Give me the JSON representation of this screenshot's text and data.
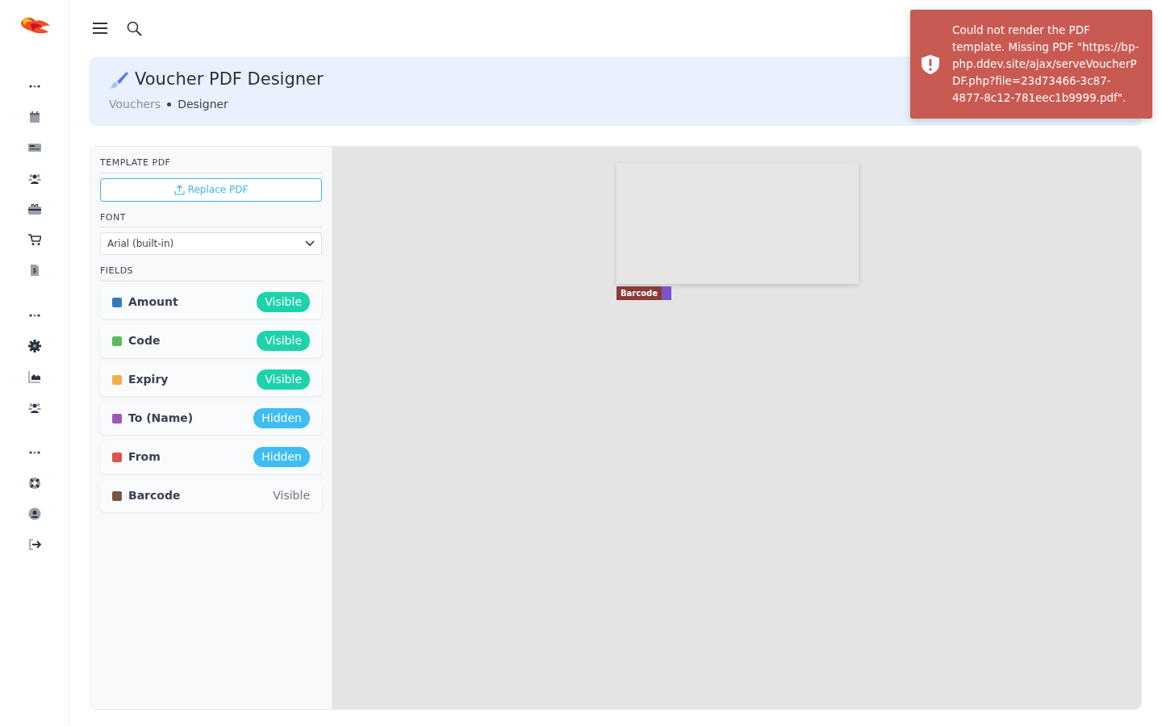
{
  "header": {
    "title": "Voucher PDF Designer",
    "breadcrumbs": [
      {
        "label": "Vouchers",
        "selected": false
      },
      {
        "label": "Designer",
        "selected": true
      }
    ]
  },
  "sections": {
    "template": "TEMPLATE PDF",
    "replace_button": "Replace PDF",
    "font": "FONT",
    "font_value": "Arial (built-in)",
    "fields": "FIELDS"
  },
  "fields": [
    {
      "name": "Amount",
      "color": "#337ab7",
      "status": "Visible",
      "kind": "visible"
    },
    {
      "name": "Code",
      "color": "#5cb85c",
      "status": "Visible",
      "kind": "visible"
    },
    {
      "name": "Expiry",
      "color": "#f0ad4e",
      "status": "Visible",
      "kind": "visible"
    },
    {
      "name": "To (Name)",
      "color": "#9b59b6",
      "status": "Hidden",
      "kind": "hidden"
    },
    {
      "name": "From",
      "color": "#d9534f",
      "status": "Hidden",
      "kind": "hidden"
    },
    {
      "name": "Barcode",
      "color": "#795548",
      "status": "Visible",
      "kind": "plain"
    }
  ],
  "canvas": {
    "marker": "Barcode"
  },
  "toast": {
    "message": "Could not render the PDF template. Missing PDF \"https://bp-php.ddev.site/ajax/serveVoucherPDF.php?file=23d73466-3c87-4877-8c12-781eec1b9999.pdf\"."
  }
}
